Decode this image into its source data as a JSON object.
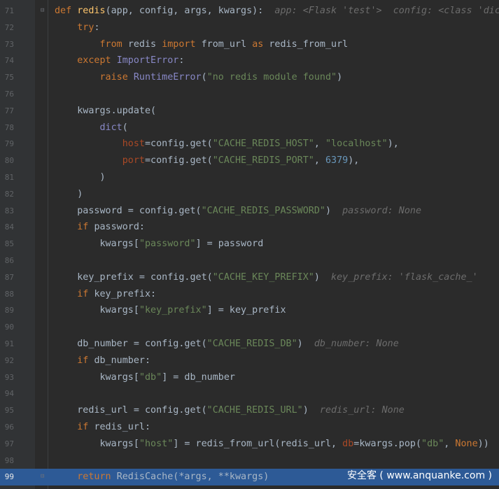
{
  "editor": {
    "lines": [
      {
        "n": "71",
        "fold": "⊟",
        "tokens": [
          [
            "kw",
            "def "
          ],
          [
            "fn",
            "redis"
          ],
          [
            "",
            "(app, config, args, kwargs):  "
          ],
          [
            "hint",
            "app: <Flask 'test'>  config: <class 'dict'>"
          ]
        ]
      },
      {
        "n": "72",
        "tokens": [
          [
            "",
            "    "
          ],
          [
            "kw",
            "try"
          ],
          [
            "",
            ":"
          ]
        ]
      },
      {
        "n": "73",
        "tokens": [
          [
            "",
            "        "
          ],
          [
            "kw",
            "from "
          ],
          [
            "",
            "redis "
          ],
          [
            "kw",
            "import "
          ],
          [
            "",
            "from_url "
          ],
          [
            "kw",
            "as "
          ],
          [
            "",
            "redis_from_url"
          ]
        ]
      },
      {
        "n": "74",
        "tokens": [
          [
            "",
            "    "
          ],
          [
            "kw",
            "except "
          ],
          [
            "bi",
            "ImportError"
          ],
          [
            "",
            ":"
          ]
        ]
      },
      {
        "n": "75",
        "tokens": [
          [
            "",
            "        "
          ],
          [
            "kw",
            "raise "
          ],
          [
            "bi",
            "RuntimeError"
          ],
          [
            "",
            "("
          ],
          [
            "st",
            "\"no redis module found\""
          ],
          [
            "",
            ")"
          ]
        ]
      },
      {
        "n": "76",
        "tokens": []
      },
      {
        "n": "77",
        "tokens": [
          [
            "",
            "    kwargs.update("
          ]
        ]
      },
      {
        "n": "78",
        "tokens": [
          [
            "",
            "        "
          ],
          [
            "bi",
            "dict"
          ],
          [
            "",
            "("
          ]
        ]
      },
      {
        "n": "79",
        "tokens": [
          [
            "",
            "            "
          ],
          [
            "pa",
            "host"
          ],
          [
            "",
            "=config.get("
          ],
          [
            "st",
            "\"CACHE_REDIS_HOST\""
          ],
          [
            "",
            ", "
          ],
          [
            "st",
            "\"localhost\""
          ],
          [
            "",
            "),"
          ]
        ]
      },
      {
        "n": "80",
        "tokens": [
          [
            "",
            "            "
          ],
          [
            "pa",
            "port"
          ],
          [
            "",
            "=config.get("
          ],
          [
            "st",
            "\"CACHE_REDIS_PORT\""
          ],
          [
            "",
            ", "
          ],
          [
            "nu",
            "6379"
          ],
          [
            "",
            "),"
          ]
        ]
      },
      {
        "n": "81",
        "tokens": [
          [
            "",
            "        )"
          ]
        ]
      },
      {
        "n": "82",
        "tokens": [
          [
            "",
            "    )"
          ]
        ]
      },
      {
        "n": "83",
        "tokens": [
          [
            "",
            "    password = config.get("
          ],
          [
            "st",
            "\"CACHE_REDIS_PASSWORD\""
          ],
          [
            "",
            ")  "
          ],
          [
            "hint",
            "password: None"
          ]
        ]
      },
      {
        "n": "84",
        "tokens": [
          [
            "",
            "    "
          ],
          [
            "kw",
            "if "
          ],
          [
            "",
            "password:"
          ]
        ]
      },
      {
        "n": "85",
        "tokens": [
          [
            "",
            "        kwargs["
          ],
          [
            "st",
            "\"password\""
          ],
          [
            "",
            "] = password"
          ]
        ]
      },
      {
        "n": "86",
        "tokens": []
      },
      {
        "n": "87",
        "tokens": [
          [
            "",
            "    key_prefix = config.get("
          ],
          [
            "st",
            "\"CACHE_KEY_PREFIX\""
          ],
          [
            "",
            ")  "
          ],
          [
            "hint",
            "key_prefix: 'flask_cache_'"
          ]
        ]
      },
      {
        "n": "88",
        "tokens": [
          [
            "",
            "    "
          ],
          [
            "kw",
            "if "
          ],
          [
            "",
            "key_prefix:"
          ]
        ]
      },
      {
        "n": "89",
        "tokens": [
          [
            "",
            "        kwargs["
          ],
          [
            "st",
            "\"key_prefix\""
          ],
          [
            "",
            "] = key_prefix"
          ]
        ]
      },
      {
        "n": "90",
        "tokens": []
      },
      {
        "n": "91",
        "tokens": [
          [
            "",
            "    db_number = config.get("
          ],
          [
            "st",
            "\"CACHE_REDIS_DB\""
          ],
          [
            "",
            ")  "
          ],
          [
            "hint",
            "db_number: None"
          ]
        ]
      },
      {
        "n": "92",
        "tokens": [
          [
            "",
            "    "
          ],
          [
            "kw",
            "if "
          ],
          [
            "",
            "db_number:"
          ]
        ]
      },
      {
        "n": "93",
        "tokens": [
          [
            "",
            "        kwargs["
          ],
          [
            "st",
            "\"db\""
          ],
          [
            "",
            "] = db_number"
          ]
        ]
      },
      {
        "n": "94",
        "tokens": []
      },
      {
        "n": "95",
        "tokens": [
          [
            "",
            "    redis_url = config.get("
          ],
          [
            "st",
            "\"CACHE_REDIS_URL\""
          ],
          [
            "",
            ")  "
          ],
          [
            "hint",
            "redis_url: None"
          ]
        ]
      },
      {
        "n": "96",
        "tokens": [
          [
            "",
            "    "
          ],
          [
            "kw",
            "if "
          ],
          [
            "",
            "redis_url:"
          ]
        ]
      },
      {
        "n": "97",
        "tokens": [
          [
            "",
            "        kwargs["
          ],
          [
            "st",
            "\"host\""
          ],
          [
            "",
            "] = redis_from_url(redis_url, "
          ],
          [
            "pa",
            "db"
          ],
          [
            "",
            "=kwargs.pop("
          ],
          [
            "st",
            "\"db\""
          ],
          [
            "",
            ", "
          ],
          [
            "kw",
            "None"
          ],
          [
            "",
            "))"
          ]
        ]
      },
      {
        "n": "98",
        "tokens": []
      },
      {
        "n": "99",
        "fold": "⊟",
        "current": true,
        "tokens": [
          [
            "",
            "    "
          ],
          [
            "kw",
            "return "
          ],
          [
            "",
            "RedisCache(*args, **kwargs)"
          ]
        ]
      }
    ]
  },
  "watermark": "安全客 ( www.anquanke.com )"
}
